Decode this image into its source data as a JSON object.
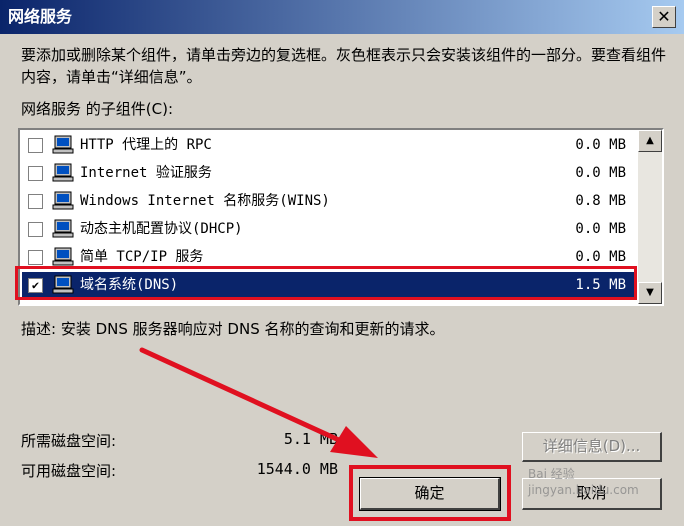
{
  "window": {
    "title": "网络服务",
    "close_glyph": "✕"
  },
  "description": "要添加或删除某个组件，请单击旁边的复选框。灰色框表示只会安装该组件的一部分。要查看组件内容，请单击“详细信息”。",
  "subcomponents_label": "网络服务 的子组件(C):",
  "components": [
    {
      "name": "HTTP 代理上的 RPC",
      "size": "0.0 MB",
      "checked": false
    },
    {
      "name": "Internet 验证服务",
      "size": "0.0 MB",
      "checked": false
    },
    {
      "name": "Windows Internet 名称服务(WINS)",
      "size": "0.8 MB",
      "checked": false
    },
    {
      "name": "动态主机配置协议(DHCP)",
      "size": "0.0 MB",
      "checked": false
    },
    {
      "name": "简单 TCP/IP 服务",
      "size": "0.0 MB",
      "checked": false
    },
    {
      "name": "域名系统(DNS)",
      "size": "1.5 MB",
      "checked": true
    }
  ],
  "detail_description": "描述:  安装 DNS 服务器响应对 DNS 名称的查询和更新的请求。",
  "disk": {
    "required_label": "所需磁盘空间:",
    "required_value": "5.1 MB",
    "available_label": "可用磁盘空间:",
    "available_value": "1544.0 MB"
  },
  "buttons": {
    "details": "详细信息(D)...",
    "ok": "确定",
    "cancel": "取消"
  },
  "watermark": {
    "line1": "Bai 经验",
    "line2": "jingyan.baidu.com"
  },
  "colors": {
    "annotation_red": "#e01020",
    "selection_blue": "#0a246a"
  }
}
